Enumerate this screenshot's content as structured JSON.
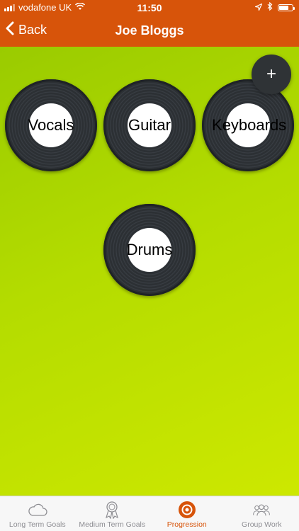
{
  "status_bar": {
    "carrier": "vodafone UK",
    "time": "11:50"
  },
  "nav": {
    "back_label": "Back",
    "title": "Joe Bloggs"
  },
  "instruments": [
    {
      "label": "Vocals"
    },
    {
      "label": "Guitar"
    },
    {
      "label": "Keyboards"
    },
    {
      "label": "Drums"
    }
  ],
  "add_button": {
    "label": "+"
  },
  "tabs": [
    {
      "label": "Long Term Goals",
      "icon": "cloud-icon",
      "active": false
    },
    {
      "label": "Medium Term Goals",
      "icon": "award-ribbon-icon",
      "active": false
    },
    {
      "label": "Progression",
      "icon": "target-icon",
      "active": true
    },
    {
      "label": "Group Work",
      "icon": "group-icon",
      "active": false
    }
  ],
  "colors": {
    "header": "#d7540a",
    "gradient_start": "#9acb00",
    "gradient_end": "#cde800",
    "tab_active": "#d7540a",
    "tab_inactive": "#8e8e93",
    "record": "#2c3034"
  }
}
